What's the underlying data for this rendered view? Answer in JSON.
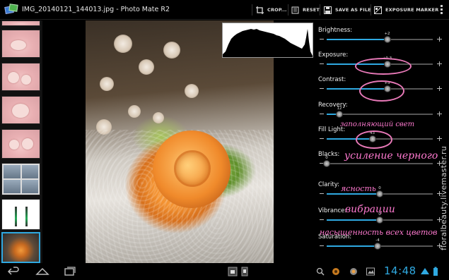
{
  "app": {
    "title": "IMG_20140121_144013.jpg - Photo Mate R2",
    "icon": "photo-mate-icon"
  },
  "toolbar": {
    "crop_label": "CROP...",
    "reset_label": "RESET",
    "save_label": "SAVE AS FILE",
    "exposure_marker_label": "EXPOSURE MARKER",
    "menu_icon": "overflow-menu-icon"
  },
  "filmstrip": {
    "selected_index": 7
  },
  "adjustments": [
    {
      "label": "Brightness:",
      "value": "+2",
      "level": 0.57
    },
    {
      "label": "Exposure:",
      "value": "+0.3",
      "level": 0.57
    },
    {
      "label": "Contrast:",
      "value": "+3",
      "level": 0.57
    },
    {
      "label": "Recovery:",
      "value": "12",
      "level": 0.12
    },
    {
      "label": "Fill Light:",
      "value": "43",
      "level": 0.43
    },
    {
      "label": "Blacks:",
      "value": "0",
      "level": 0.0
    },
    {
      "label": "Clarity:",
      "value": "0",
      "level": 0.5
    },
    {
      "label": "Vibrance:",
      "value": "0",
      "level": 0.5
    },
    {
      "label": "Saturation:",
      "value": "-4",
      "level": 0.48
    }
  ],
  "annotations": {
    "fill_light_note": "заполняющий свет",
    "blacks_note": "усиление черного",
    "clarity_note": "ясность",
    "vibrance_note": "вибрации",
    "saturation_note": "насыщенность всех цветов",
    "color": "#ff7ad0"
  },
  "watermark": "floralbeauty.livemaster.ru",
  "status": {
    "time": "14:48",
    "accent": "#2fa9e1"
  }
}
